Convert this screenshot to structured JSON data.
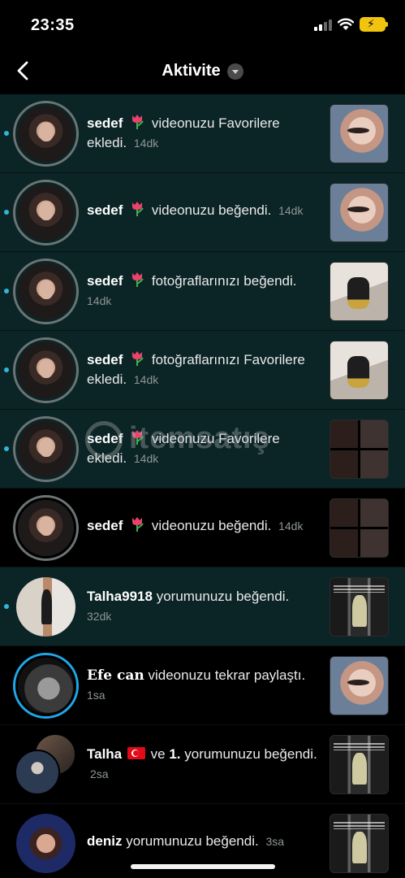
{
  "status_bar": {
    "time": "23:35"
  },
  "nav": {
    "title": "Aktivite"
  },
  "watermark": {
    "text": "itemsatış"
  },
  "notifications": [
    {
      "user": "sedef",
      "action": "videonuzu Favorilere ekledi.",
      "time": "14dk",
      "unread": true
    },
    {
      "user": "sedef",
      "action": "videonuzu beğendi.",
      "time": "14dk",
      "unread": true
    },
    {
      "user": "sedef",
      "action": "fotoğraflarınızı beğendi.",
      "time": "14dk",
      "unread": true
    },
    {
      "user": "sedef",
      "action": "fotoğraflarınızı Favorilere ekledi.",
      "time": "14dk",
      "unread": true
    },
    {
      "user": "sedef",
      "action": "videonuzu Favorilere ekledi.",
      "time": "14dk",
      "unread": true
    },
    {
      "user": "sedef",
      "action": "videonuzu beğendi.",
      "time": "14dk",
      "unread": false
    },
    {
      "user": "Talha9918",
      "action": "yorumunuzu beğendi.",
      "time": "32dk",
      "unread": true
    },
    {
      "user": "Efe can",
      "action": "videonuzu tekrar paylaştı.",
      "time": "1sa",
      "unread": false
    },
    {
      "user": "Talha",
      "connector": "ve",
      "user2": "1.",
      "action": "yorumunuzu beğendi.",
      "time": "2sa",
      "unread": false
    },
    {
      "user": "deniz",
      "action": "yorumunuzu beğendi.",
      "time": "3sa",
      "unread": false
    }
  ]
}
